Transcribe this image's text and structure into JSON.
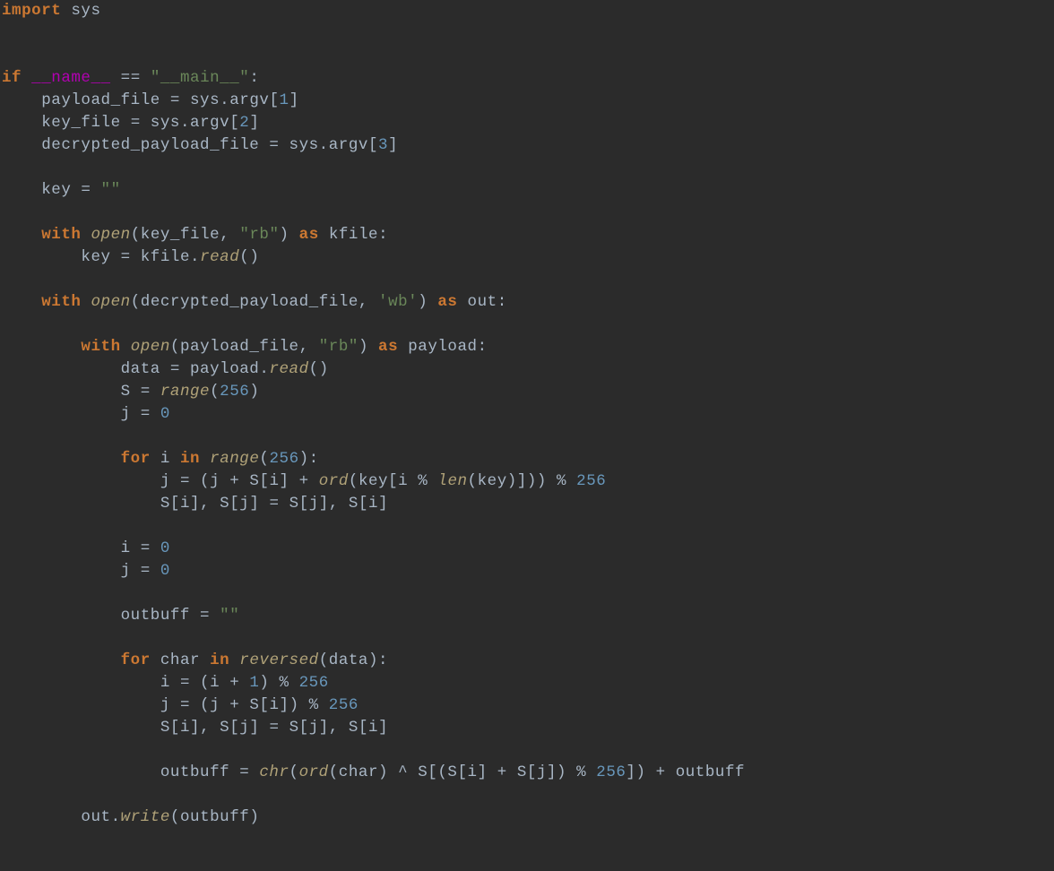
{
  "lang": "python",
  "tokens": {
    "kw_import": "import",
    "kw_if": "if",
    "kw_with": "with",
    "kw_as": "as",
    "kw_for": "for",
    "kw_in": "in",
    "mod_sys": "sys",
    "dunder_name": "__name__",
    "dunder_main_str": "\"__main__\"",
    "id_payload_file": "payload_file",
    "id_key_file": "key_file",
    "id_decrypted_payload_file": "decrypted_payload_file",
    "id_key": "key",
    "id_kfile": "kfile",
    "id_out": "out",
    "id_payload": "payload",
    "id_data": "data",
    "id_S": "S",
    "id_j": "j",
    "id_i": "i",
    "id_outbuff": "outbuff",
    "id_char": "char",
    "id_argv": "argv",
    "fn_open": "open",
    "fn_range": "range",
    "fn_ord": "ord",
    "fn_len": "len",
    "fn_chr": "chr",
    "fn_reversed": "reversed",
    "fn_read": "read",
    "fn_write": "write",
    "str_rb": "\"rb\"",
    "str_wb": "'wb'",
    "str_rb2": "\"rb\"",
    "str_empty1": "\"\"",
    "str_empty2": "\"\"",
    "num_1": "1",
    "num_2": "2",
    "num_3": "3",
    "num_256a": "256",
    "num_0a": "0",
    "num_256b": "256",
    "num_256c": "256",
    "num_0b": "0",
    "num_0c": "0",
    "num_1b": "1",
    "num_256d": "256",
    "num_256e": "256",
    "num_256f": "256"
  },
  "source": "import sys\n\n\nif __name__ == \"__main__\":\n    payload_file = sys.argv[1]\n    key_file = sys.argv[2]\n    decrypted_payload_file = sys.argv[3]\n\n    key = \"\"\n\n    with open(key_file, \"rb\") as kfile:\n        key = kfile.read()\n\n    with open(decrypted_payload_file, 'wb') as out:\n\n        with open(payload_file, \"rb\") as payload:\n            data = payload.read()\n            S = range(256)\n            j = 0\n\n            for i in range(256):\n                j = (j + S[i] + ord(key[i % len(key)])) % 256\n                S[i], S[j] = S[j], S[i]\n\n            i = 0\n            j = 0\n\n            outbuff = \"\"\n\n            for char in reversed(data):\n                i = (i + 1) % 256\n                j = (j + S[i]) % 256\n                S[i], S[j] = S[j], S[i]\n\n                outbuff = chr(ord(char) ^ S[(S[i] + S[j]) % 256]) + outbuff\n\n        out.write(outbuff)\n"
}
